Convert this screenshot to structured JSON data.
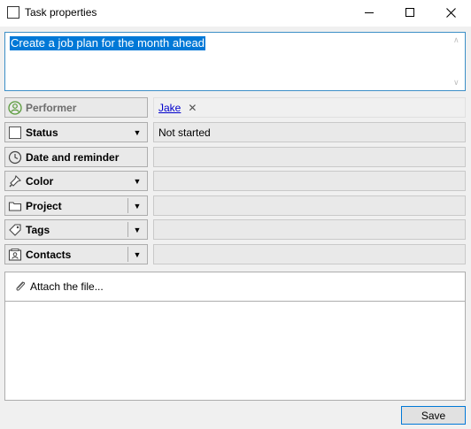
{
  "window": {
    "title": "Task properties"
  },
  "task": {
    "text": "Create a job plan for the month ahead"
  },
  "fields": {
    "performer": {
      "label": "Performer",
      "value": "Jake"
    },
    "status": {
      "label": "Status",
      "value": "Not started"
    },
    "date": {
      "label": "Date and reminder",
      "value": ""
    },
    "color": {
      "label": "Color",
      "value": ""
    },
    "project": {
      "label": "Project",
      "value": ""
    },
    "tags": {
      "label": "Tags",
      "value": ""
    },
    "contacts": {
      "label": "Contacts",
      "value": ""
    }
  },
  "attachments": {
    "label": "Attach the file..."
  },
  "footer": {
    "save_label": "Save"
  },
  "colors": {
    "selection": "#0078d7",
    "focus_border": "#3c8fc7",
    "link": "#0000cc"
  }
}
